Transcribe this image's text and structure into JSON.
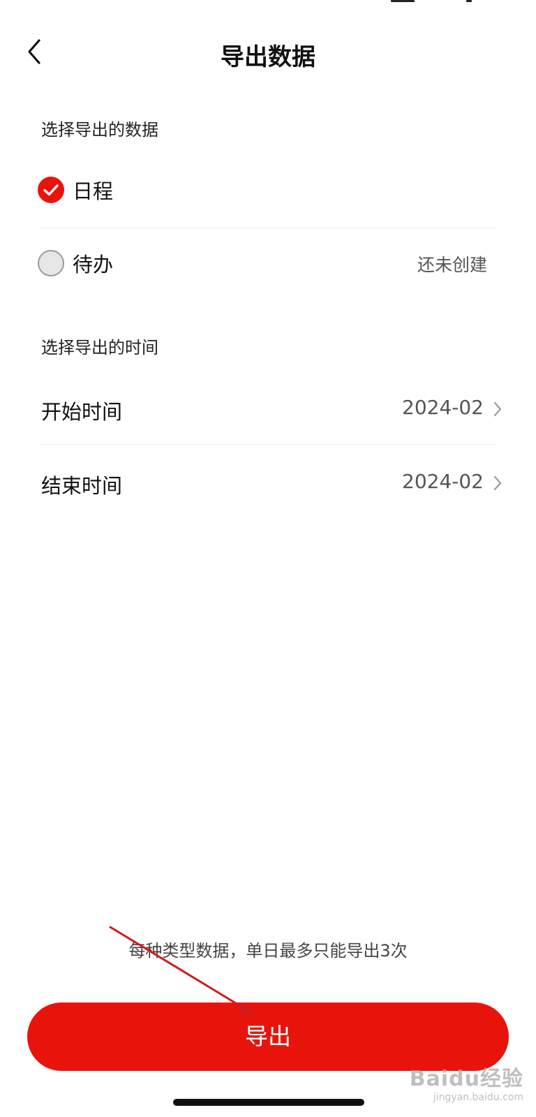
{
  "header": {
    "title": "导出数据"
  },
  "data_section": {
    "label": "选择导出的数据",
    "options": [
      {
        "label": "日程",
        "checked": true,
        "hint": ""
      },
      {
        "label": "待办",
        "checked": false,
        "hint": "还未创建"
      }
    ]
  },
  "time_section": {
    "label": "选择导出的时间",
    "rows": [
      {
        "label": "开始时间",
        "value": "2024-02"
      },
      {
        "label": "结束时间",
        "value": "2024-02"
      }
    ]
  },
  "footer": {
    "notice": "每种类型数据，单日最多只能导出3次",
    "export_label": "导出"
  },
  "watermark": {
    "main": "Baidu经验",
    "sub": "jingyan.baidu.com"
  },
  "colors": {
    "accent": "#e8140c",
    "annotation_arrow": "#d11a1a"
  },
  "icons": [
    "back-icon",
    "checked-icon",
    "unchecked-icon",
    "chevron-right-icon"
  ]
}
